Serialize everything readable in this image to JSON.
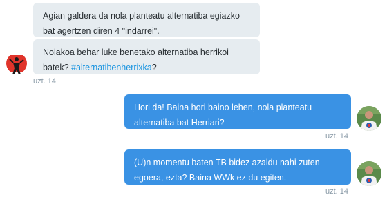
{
  "thread": {
    "incoming": [
      {
        "text": "Agian galdera da nola planteatu alternatiba egiazko bat agertzen diren 4 \"indarrei\"."
      },
      {
        "text_before": "Nolakoa behar luke benetako alternatiba herrikoi batek? ",
        "hashtag": "#alternatibenherrixka",
        "text_after": "?"
      }
    ],
    "incoming_timestamp": "uzt. 14",
    "outgoing": [
      {
        "text": "Hori da! Baina hori baino lehen, nola planteatu alternatiba bat Herriari?",
        "timestamp": "uzt. 14"
      },
      {
        "text": "(U)n momentu baten TB bidez azaldu nahi zuten egoera, ezta? Baina WWk ez du egiten.",
        "timestamp": "uzt. 14"
      }
    ]
  },
  "colors": {
    "incoming_bubble": "#e6ecf0",
    "outgoing_bubble": "#3a92e4",
    "hashtag": "#1b95e0",
    "timestamp": "#8899a6"
  },
  "icons": {
    "sender_avatar": "red-sun-figure-avatar",
    "user_avatar": "person-photo-avatar"
  }
}
